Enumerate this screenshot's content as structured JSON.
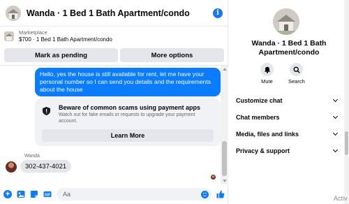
{
  "header": {
    "title": "Wanda · 1 Bed 1 Bath Apartment/condo",
    "info_icon": "info-icon"
  },
  "listing": {
    "kicker": "Marketplace",
    "description": "$700 · 1 Bed 1 Bath Apartment/condo",
    "pending_label": "Mark as pending",
    "more_label": "More options"
  },
  "messages": {
    "outgoing_text": "Hello, yes the house is still available for rent, let me have your personal number so I can send you details and the requirements about the house",
    "scam_title": "Beware of common scams using payment apps",
    "scam_subtitle": "Watch out for fake emails or requests to upgrade your payment account.",
    "learn_more_label": "Learn More",
    "sender_name": "Wanda",
    "incoming_text": "302-437-4021"
  },
  "composer": {
    "placeholder": "Aa",
    "icons": [
      "plus-icon",
      "image-icon",
      "sticker-icon",
      "gif-icon",
      "emoji-icon",
      "like-icon"
    ]
  },
  "panel": {
    "name": "Wanda · 1 Bed 1 Bath Apartment/condo",
    "mute_label": "Mute",
    "search_label": "Search",
    "menu": [
      {
        "label": "Customize chat"
      },
      {
        "label": "Chat members"
      },
      {
        "label": "Media, files and links"
      },
      {
        "label": "Privacy & support"
      }
    ]
  },
  "watermark": "Activ",
  "colors": {
    "accent": "#0a7cff",
    "brand": "#1877f2",
    "bubble_in": "#e4e6eb",
    "muted_text": "#65676b"
  }
}
